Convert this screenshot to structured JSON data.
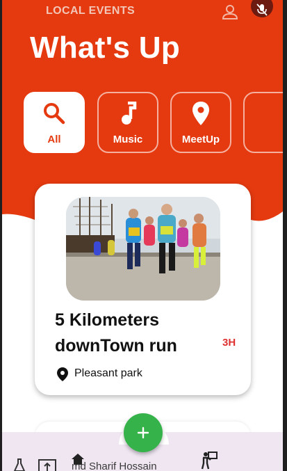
{
  "header": {
    "app_label": "LOCAL EVENTS",
    "title": "What's Up",
    "accent_color": "#e53a10"
  },
  "categories": [
    {
      "label": "All",
      "icon": "search-icon",
      "selected": true
    },
    {
      "label": "Music",
      "icon": "music-note-icon",
      "selected": false
    },
    {
      "label": "MeetUp",
      "icon": "location-pin-icon",
      "selected": false
    },
    {
      "label": "",
      "icon": "partially-visible-category",
      "selected": false
    }
  ],
  "events": [
    {
      "title": "5 Kilometers downTown run",
      "time_ago": "3H",
      "location": "Pleasant park",
      "image": "runners-marathon-photo"
    }
  ],
  "bottom_nav": {
    "user_name": "md Sharif Hossain",
    "fab_icon": "plus-icon",
    "fab_color": "#36b24a"
  }
}
